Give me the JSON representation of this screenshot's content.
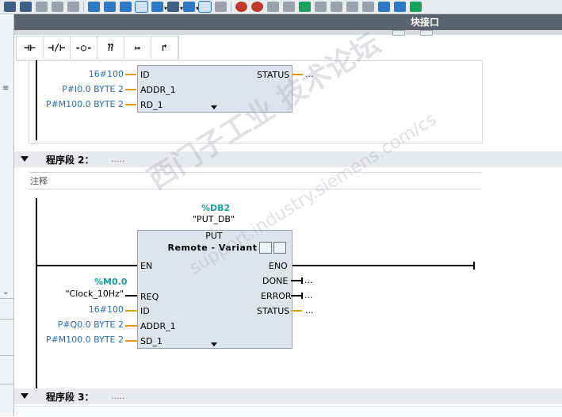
{
  "header": {
    "title": "块接口"
  },
  "palette": [
    "⊣⊢",
    "⊣/⊢",
    "-○-",
    "⁇",
    "↦",
    "↱"
  ],
  "network1": {
    "params": {
      "id": "16#100",
      "addr": "P#I0.0 BYTE 2",
      "rd": "P#M100.0 BYTE 2"
    },
    "pins": {
      "id": "ID",
      "addr": "ADDR_1",
      "rd": "RD_1",
      "status": "STATUS"
    },
    "status_value": "..."
  },
  "network2": {
    "label": "程序段 2：",
    "dots": ".....",
    "comment": "注释",
    "db_name": "%DB2",
    "db_symbol": "\"PUT_DB\"",
    "fb_name": "PUT",
    "fb_sub": "Remote - Variant",
    "pins_left": {
      "en": "EN",
      "req": "REQ",
      "id": "ID",
      "addr": "ADDR_1",
      "sd": "SD_1"
    },
    "pins_right": {
      "eno": "ENO",
      "done": "DONE",
      "error": "ERROR",
      "status": "STATUS"
    },
    "req_addr": "%M0.0",
    "req_symbol": "\"Clock_10Hz\"",
    "id_value": "16#100",
    "addr_value": "P#Q0.0 BYTE 2",
    "sd_value": "P#M100.0 BYTE 2",
    "out_dots": "..."
  },
  "network3": {
    "label": "程序段 3：",
    "dots": "....."
  },
  "watermark": {
    "line1": "西门子工业 技术论坛",
    "line2": "support.industry.siemens.com/cs"
  }
}
